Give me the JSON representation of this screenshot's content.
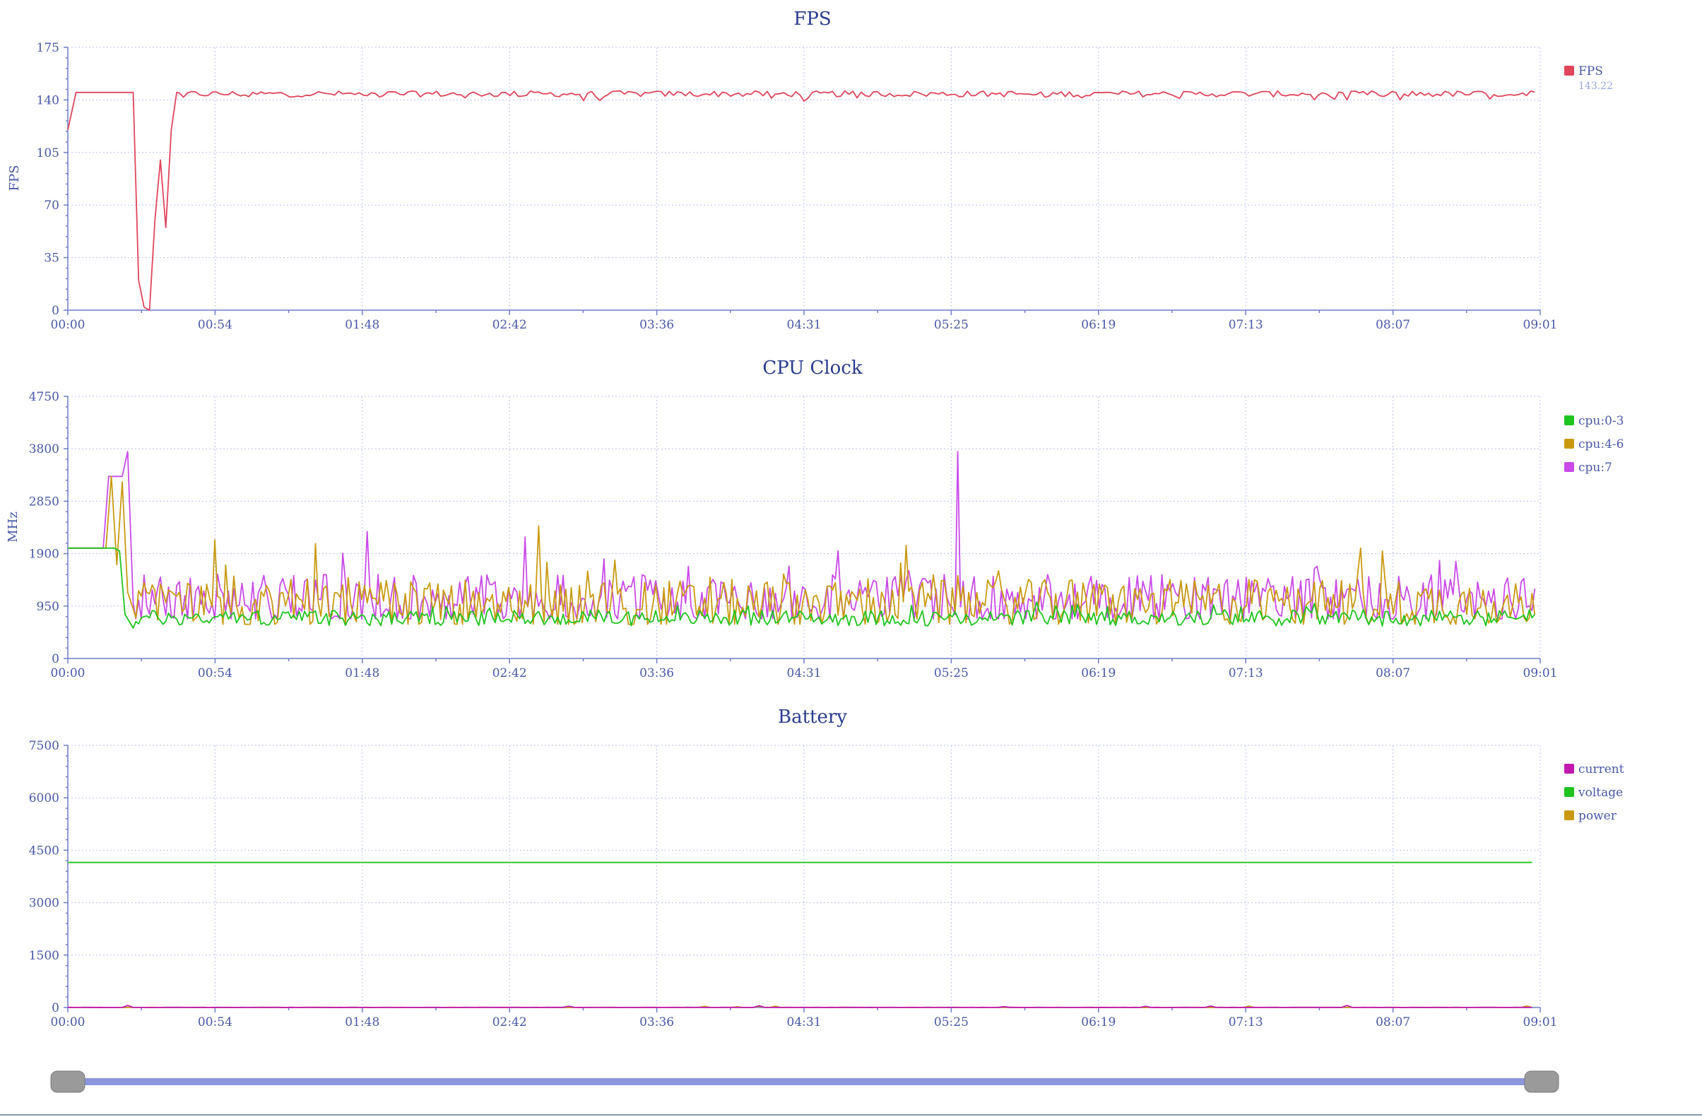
{
  "x_ticks": [
    "00:00",
    "00:54",
    "01:48",
    "02:42",
    "03:36",
    "04:31",
    "05:25",
    "06:19",
    "07:13",
    "08:07",
    "09:01"
  ],
  "colors": {
    "title": "#2a3b8f",
    "fps": "#e0455c",
    "cpu_0_3": "#1fc41f",
    "cpu_4_6": "#c99a10",
    "cpu_7": "#c94ae8",
    "current": "#c219b0",
    "voltage": "#1fc41f",
    "power": "#c99a10"
  },
  "slider": {
    "range_start": 0.0,
    "range_end": 1.0
  },
  "chart_data": [
    {
      "type": "line",
      "title": "FPS",
      "xlabel": "",
      "ylabel": "FPS",
      "x_range": [
        "00:00",
        "09:01"
      ],
      "ylim": [
        0,
        175
      ],
      "y_ticks": [
        "0",
        "35",
        "70",
        "105",
        "140",
        "175"
      ],
      "grid": true,
      "legend_position": "right",
      "series": [
        {
          "name": "FPS",
          "color": "#e0455c",
          "legend_value": "143.22",
          "description": "Starts ~120, rises to 145, drops to 0 near 00:14, recovers to ~100/55 and then stays ~143 (range 138-146) until 09:01",
          "points": [
            [
              0,
              120
            ],
            [
              3,
              145
            ],
            [
              24,
              145
            ],
            [
              26,
              20
            ],
            [
              28,
              2
            ],
            [
              30,
              0
            ],
            [
              32,
              60
            ],
            [
              34,
              100
            ],
            [
              36,
              55
            ],
            [
              38,
              120
            ],
            [
              40,
              145
            ],
            [
              540,
              145
            ]
          ]
        }
      ]
    },
    {
      "type": "line",
      "title": "CPU Clock",
      "xlabel": "",
      "ylabel": "MHz",
      "x_range": [
        "00:00",
        "09:01"
      ],
      "ylim": [
        0,
        4750
      ],
      "y_ticks": [
        "0",
        "950",
        "1900",
        "2850",
        "3800",
        "4750"
      ],
      "grid": true,
      "legend_position": "right",
      "series": [
        {
          "name": "cpu:0-3",
          "color": "#1fc41f",
          "baseline": 720,
          "amplitude": 180,
          "points": [
            [
              0,
              2000
            ],
            [
              17,
              2000
            ],
            [
              19,
              1950
            ],
            [
              21,
              800
            ],
            [
              24,
              550
            ]
          ]
        },
        {
          "name": "cpu:4-6",
          "color": "#c99a10",
          "baseline": 950,
          "amplitude": 550,
          "points": [
            [
              0,
              2000
            ],
            [
              14,
              2000
            ],
            [
              16,
              3300
            ],
            [
              18,
              1700
            ],
            [
              20,
              3200
            ],
            [
              22,
              1200
            ],
            [
              24,
              900
            ]
          ],
          "peaks": [
            [
              54,
              2150
            ],
            [
              91,
              2080
            ],
            [
              173,
              2400
            ],
            [
              308,
              2050
            ],
            [
              475,
              2000
            ],
            [
              483,
              1950
            ]
          ]
        },
        {
          "name": "cpu:7",
          "color": "#c94ae8",
          "baseline": 1000,
          "amplitude": 600,
          "points": [
            [
              0,
              2000
            ],
            [
              13,
              2000
            ],
            [
              15,
              3300
            ],
            [
              20,
              3300
            ],
            [
              22,
              3750
            ],
            [
              24,
              1000
            ]
          ],
          "peaks": [
            [
              110,
              2300
            ],
            [
              168,
              2200
            ],
            [
              327,
              3750
            ],
            [
              283,
              1950
            ]
          ]
        }
      ]
    },
    {
      "type": "line",
      "title": "Battery",
      "xlabel": "",
      "ylabel": "",
      "x_range": [
        "00:00",
        "09:01"
      ],
      "ylim": [
        0,
        7500
      ],
      "y_ticks": [
        "0",
        "1500",
        "3000",
        "4500",
        "6000",
        "7500"
      ],
      "grid": true,
      "legend_position": "right",
      "series": [
        {
          "name": "current",
          "color": "#c219b0",
          "value_approx": 0
        },
        {
          "name": "voltage",
          "color": "#1fc41f",
          "value_approx": 4150
        },
        {
          "name": "power",
          "color": "#c99a10",
          "value_approx": 0
        }
      ]
    }
  ]
}
